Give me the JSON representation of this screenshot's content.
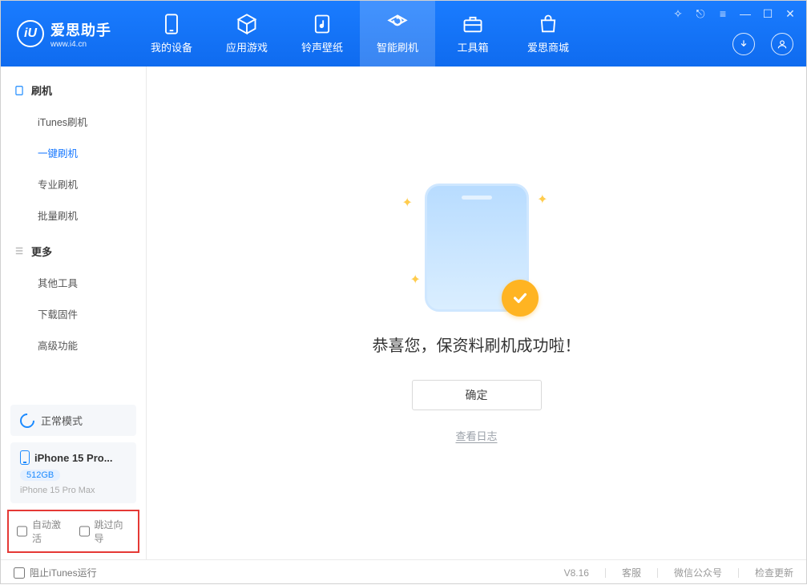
{
  "brand": {
    "name": "爱思助手",
    "url": "www.i4.cn"
  },
  "nav": [
    {
      "label": "我的设备",
      "icon": "phone"
    },
    {
      "label": "应用游戏",
      "icon": "cube"
    },
    {
      "label": "铃声壁纸",
      "icon": "music"
    },
    {
      "label": "智能刷机",
      "icon": "refresh"
    },
    {
      "label": "工具箱",
      "icon": "briefcase"
    },
    {
      "label": "爱思商城",
      "icon": "shop"
    }
  ],
  "sidebar": {
    "flash_title": "刷机",
    "flash_items": [
      "iTunes刷机",
      "一键刷机",
      "专业刷机",
      "批量刷机"
    ],
    "more_title": "更多",
    "more_items": [
      "其他工具",
      "下载固件",
      "高级功能"
    ]
  },
  "status": {
    "mode": "正常模式"
  },
  "device": {
    "name": "iPhone 15 Pro...",
    "capacity": "512GB",
    "full": "iPhone 15 Pro Max"
  },
  "options": {
    "auto_activate": "自动激活",
    "skip_wizard": "跳过向导"
  },
  "main": {
    "success": "恭喜您，保资料刷机成功啦！",
    "ok": "确定",
    "view_log": "查看日志"
  },
  "footer": {
    "block_itunes": "阻止iTunes运行",
    "version": "V8.16",
    "support": "客服",
    "wechat": "微信公众号",
    "check_update": "检查更新"
  }
}
